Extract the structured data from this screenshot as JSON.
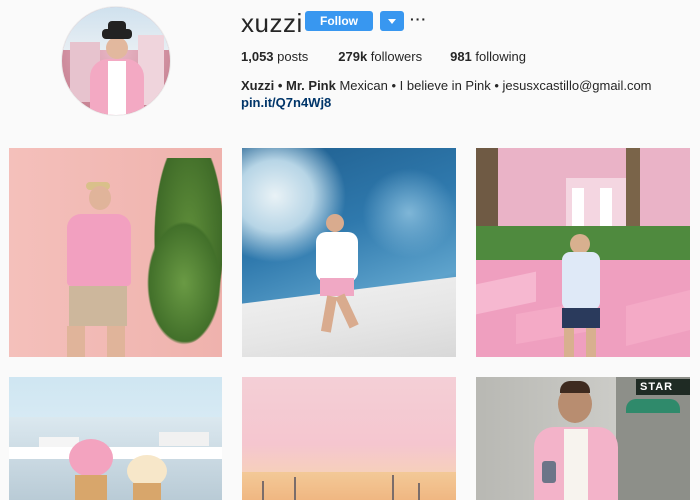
{
  "profile": {
    "username": "xuzzi",
    "follow_label": "Follow",
    "more_label": "···",
    "stats": {
      "posts_count": "1,053",
      "posts_label": "posts",
      "followers_count": "279k",
      "followers_label": "followers",
      "following_count": "981",
      "following_label": "following"
    },
    "bio_name": "Xuzzi • Mr. Pink",
    "bio_text": " Mexican • I believe in Pink • jesusxcastillo@gmail.com",
    "link": "pin.it/Q7n4Wj8"
  },
  "posts": {
    "store_sign": "STAR"
  },
  "colors": {
    "accent": "#3897f0",
    "link": "#003569"
  }
}
